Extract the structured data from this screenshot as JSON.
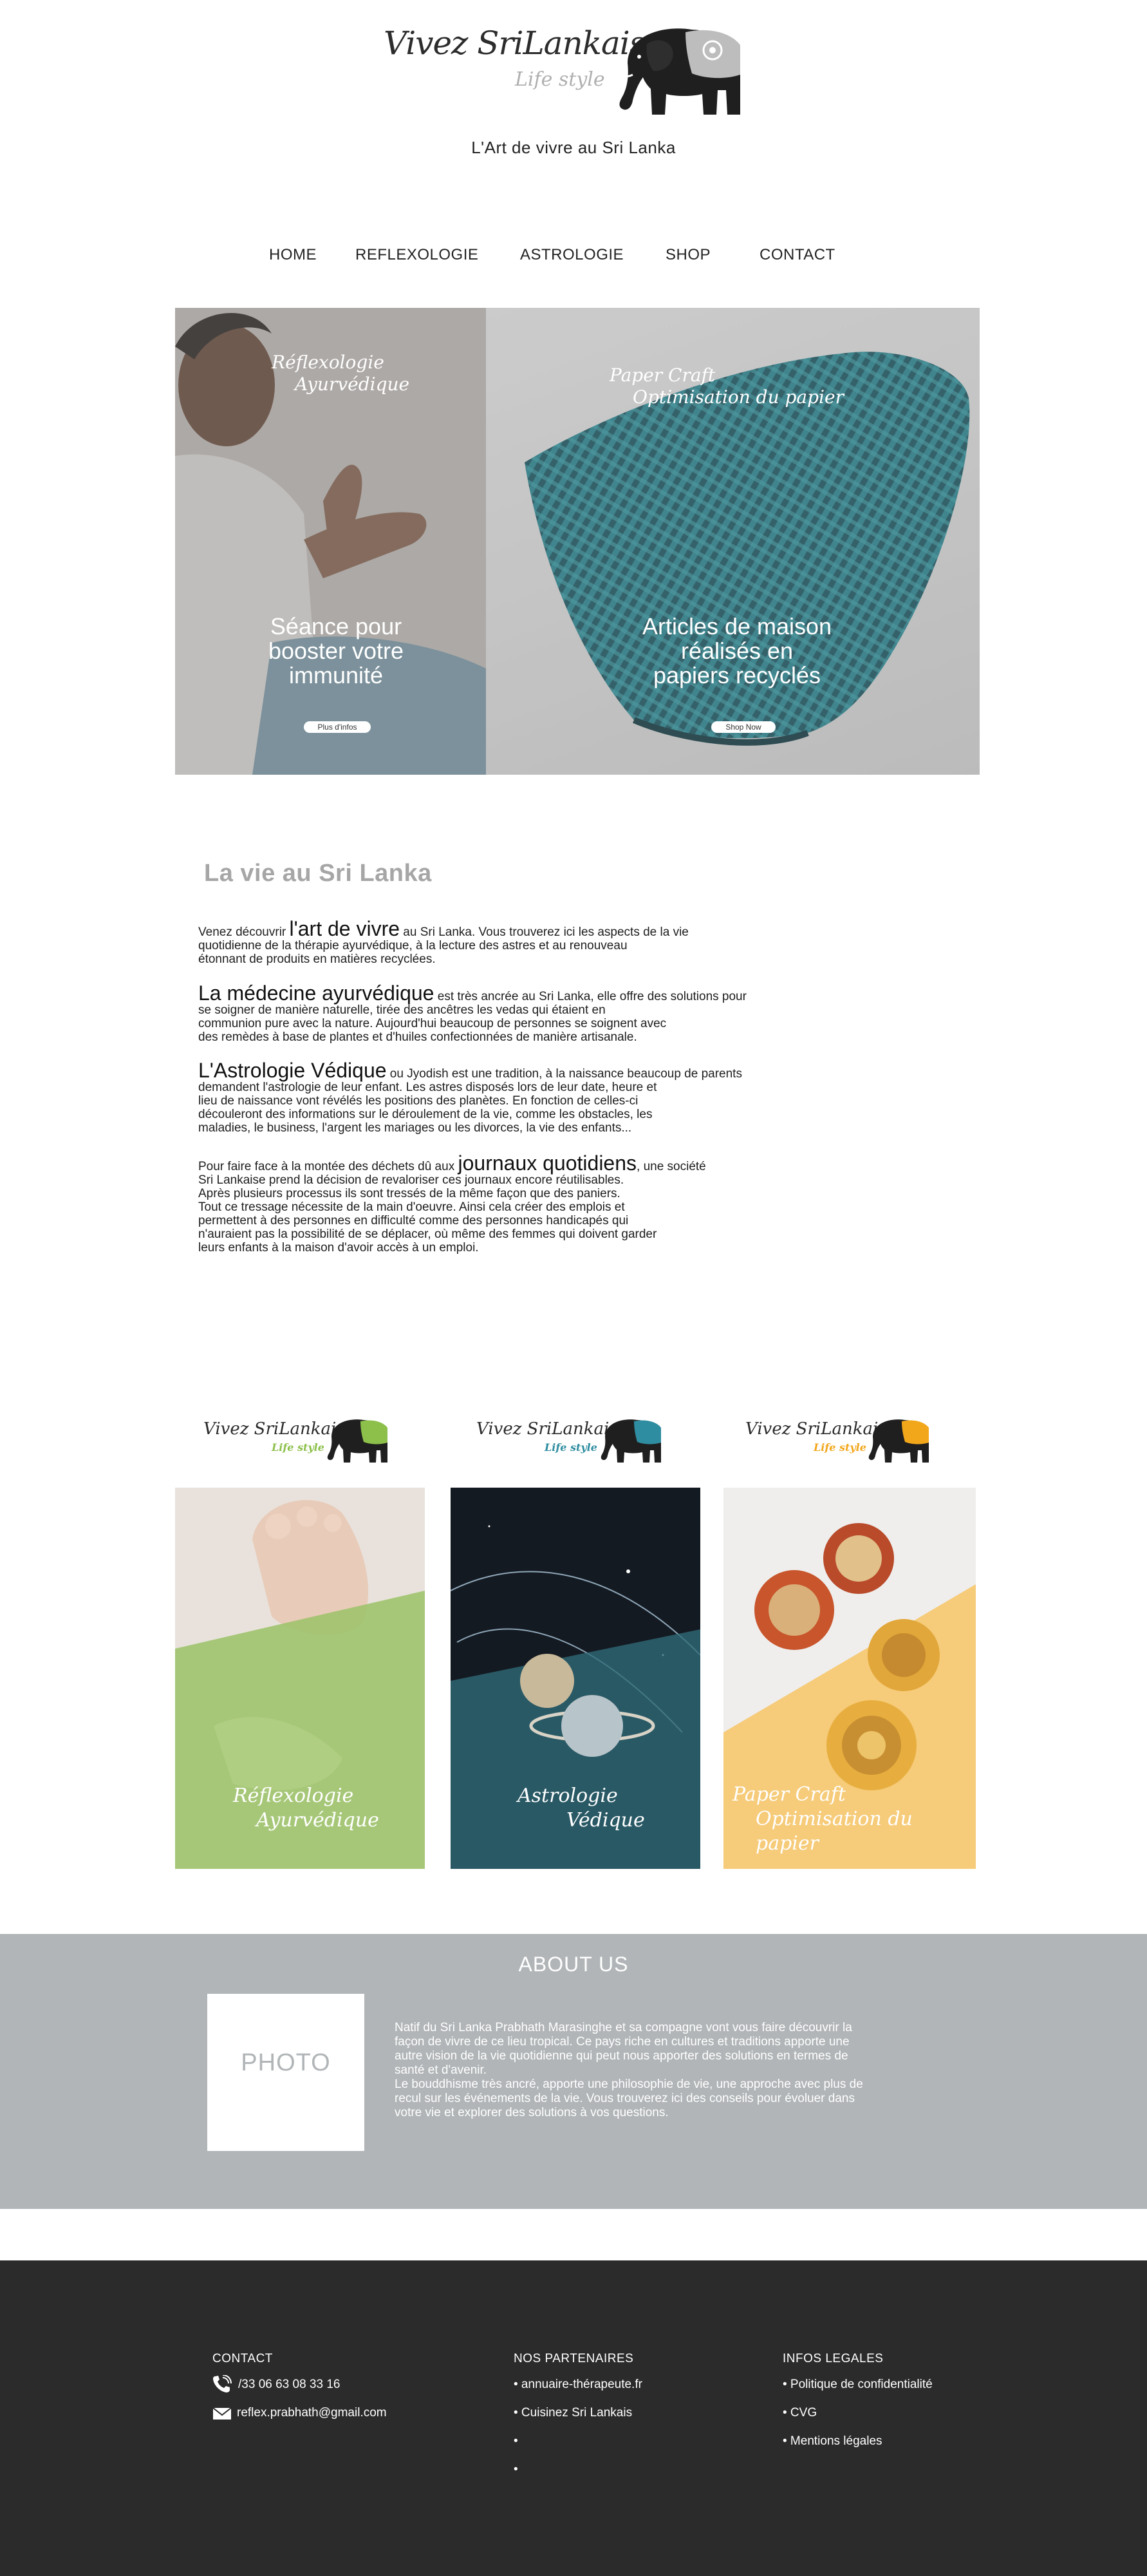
{
  "header": {
    "brand_title": "Vivez SriLankais",
    "brand_subtitle": "Life style",
    "tagline": "L'Art de vivre au Sri Lanka"
  },
  "nav": {
    "items": [
      "HOME",
      "REFLEXOLOGIE",
      "ASTROLOGIE",
      "SHOP",
      "CONTACT"
    ]
  },
  "hero": {
    "left": {
      "script_line1": "Réflexologie",
      "script_line2": "Ayurvédique",
      "headline_line1": "Séance pour",
      "headline_line2": "booster votre",
      "headline_line3": "immunité",
      "button": "Plus d'infos"
    },
    "right": {
      "script_line1": "Paper Craft",
      "script_line2": "Optimisation du papier",
      "headline_line1": "Articles de maison",
      "headline_line2": "réalisés en",
      "headline_line3": "papiers recyclés",
      "button": "Shop Now"
    }
  },
  "intro": {
    "title": "La vie au Sri Lanka",
    "p1": {
      "pre": "Venez découvrir ",
      "big": "l'art de vivre",
      "lines": [
        " au Sri Lanka. Vous trouverez ici les aspects de la vie",
        "quotidienne de la thérapie ayurvédique, à la lecture des astres et au renouveau",
        "étonnant de produits en matières recyclées."
      ]
    },
    "p2": {
      "big": "La médecine ayurvédique",
      "lines": [
        " est très ancrée au Sri Lanka, elle offre des solutions pour",
        "se soigner de manière naturelle, tirée des ancêtres les vedas qui étaient en",
        "communion pure avec la nature. Aujourd'hui beaucoup de personnes se soignent avec",
        "des remèdes à base de plantes et d'huiles confectionnées de manière artisanale."
      ]
    },
    "p3": {
      "big": "L'Astrologie Védique",
      "lines": [
        " ou Jyodish est une tradition, à la naissance beaucoup de parents",
        "demandent l'astrologie de leur enfant. Les astres disposés lors de leur date, heure et",
        "lieu de naissance vont révélés les positions des planètes. En fonction de celles-ci",
        "découleront des informations sur le déroulement de la vie, comme les obstacles, les",
        "maladies, le business, l'argent les mariages ou les divorces, la vie des enfants..."
      ]
    },
    "p4": {
      "pre": "Pour faire face à la montée des déchets dû aux ",
      "big": "journaux quotidiens",
      "lines": [
        ", une société",
        "Sri Lankaise prend la décision de revaloriser ces journaux encore réutilisables.",
        "Après plusieurs processus ils sont tressés de la même façon que des paniers.",
        "Tout ce tressage nécessite de la main d'oeuvre. Ainsi cela créer des emplois et",
        "permettent à des personnes en difficulté comme des personnes handicapés qui",
        "n'auraient pas la possibilité de se déplacer, où même des femmes qui doivent garder",
        "leurs enfants à la maison d'avoir accès à un emploi."
      ]
    }
  },
  "cards": [
    {
      "logo_title": "Vivez SriLankais",
      "logo_sub": "Life style",
      "caption1": "Réflexologie",
      "caption2": "Ayurvédique",
      "accent": "#8cc04a"
    },
    {
      "logo_title": "Vivez SriLankais",
      "logo_sub": "Life style",
      "caption1": "Astrologie",
      "caption2": "Védique",
      "accent": "#2e8da0"
    },
    {
      "logo_title": "Vivez SriLankais",
      "logo_sub": "Life style",
      "caption1": "Paper Craft",
      "caption2": "Optimisation du papier",
      "accent": "#f2a71b"
    }
  ],
  "about": {
    "title": "ABOUT US",
    "photo_label": "PHOTO",
    "lines": [
      "Natif du Sri Lanka Prabhath Marasinghe et sa compagne vont vous faire découvrir la",
      "façon de vivre de ce lieu tropical. Ce pays riche en cultures et traditions apporte une",
      "autre vision de la vie quotidienne qui peut nous apporter des solutions en termes de",
      "santé et d'avenir.",
      "Le bouddhisme très ancré, apporte une philosophie de vie, une approche avec plus de",
      "recul sur les événements de la vie. Vous trouverez ici des conseils pour évoluer dans",
      "votre vie et explorer des solutions à vos questions."
    ]
  },
  "footer": {
    "contact": {
      "heading": "CONTACT",
      "phone": "/33 06 63 08 33 16",
      "email": "reflex.prabhath@gmail.com"
    },
    "partners": {
      "heading": "NOS PARTENAIRES",
      "items": [
        "• annuaire-thérapeute.fr",
        "• Cuisinez Sri Lankais",
        "•",
        "•"
      ]
    },
    "legal": {
      "heading": "INFOS LEGALES",
      "items": [
        "• Politique de confidentialité",
        "• CVG",
        "• Mentions légales"
      ]
    }
  },
  "colors": {
    "about_bg": "#b1b5b7",
    "footer_bg": "#2b2b2b",
    "section_title": "#a6a6a6"
  },
  "icons": [
    "elephant-logo-icon",
    "phone-icon",
    "mail-icon"
  ]
}
